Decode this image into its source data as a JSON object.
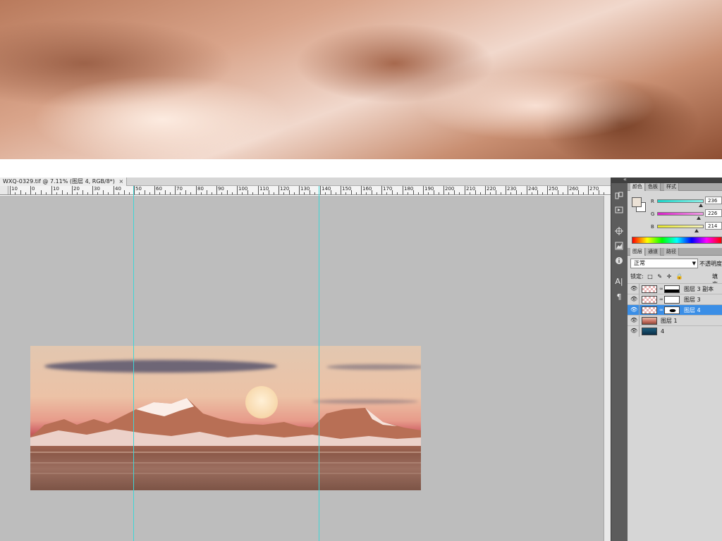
{
  "document": {
    "tab_title": "WXQ-0329.tif @ 7.11% (图层 4, RGB/8*)",
    "close_glyph": "×"
  },
  "ruler": {
    "labels": [
      "10",
      "0",
      "10",
      "20",
      "30",
      "40",
      "50",
      "60",
      "70",
      "80",
      "90",
      "100",
      "110",
      "120",
      "130",
      "140",
      "150",
      "160",
      "170",
      "180",
      "190",
      "200",
      "210",
      "220",
      "230",
      "240",
      "250",
      "260",
      "270"
    ]
  },
  "color_panel": {
    "tabs": [
      "颜色",
      "色板",
      "样式"
    ],
    "active_tab": "颜色",
    "r_label": "R",
    "g_label": "G",
    "b_label": "B",
    "r": "236",
    "g": "226",
    "b": "214",
    "r_level": 0.925,
    "g_level": 0.886,
    "b_level": 0.839,
    "foreground_color": "#ece2d6"
  },
  "layers_panel": {
    "tabs": [
      "图层",
      "通道",
      "路径"
    ],
    "active_tab": "图层",
    "blend_mode": "正常",
    "opacity_label": "不透明度",
    "lock_label": "锁定:",
    "lock_icons": "□ ✎ ✛ 🔒",
    "fill_label": "填充",
    "layers": [
      {
        "name": "图层 3 副本",
        "selected": false
      },
      {
        "name": "图层 3",
        "selected": false
      },
      {
        "name": "图层 4",
        "selected": true
      },
      {
        "name": "图层 1",
        "selected": false
      },
      {
        "name": "4",
        "selected": false
      }
    ]
  },
  "dock": {
    "collapse_glyph": "«",
    "tools": [
      "history-icon",
      "actions-play-icon",
      "navigator-icon",
      "histogram-icon",
      "info-icon",
      "character-icon",
      "paragraph-icon"
    ]
  },
  "colors": {
    "selection_accent": "#3a8ee6",
    "guide": "#3fd6d6",
    "canvas_bg": "#bdbdbd"
  }
}
